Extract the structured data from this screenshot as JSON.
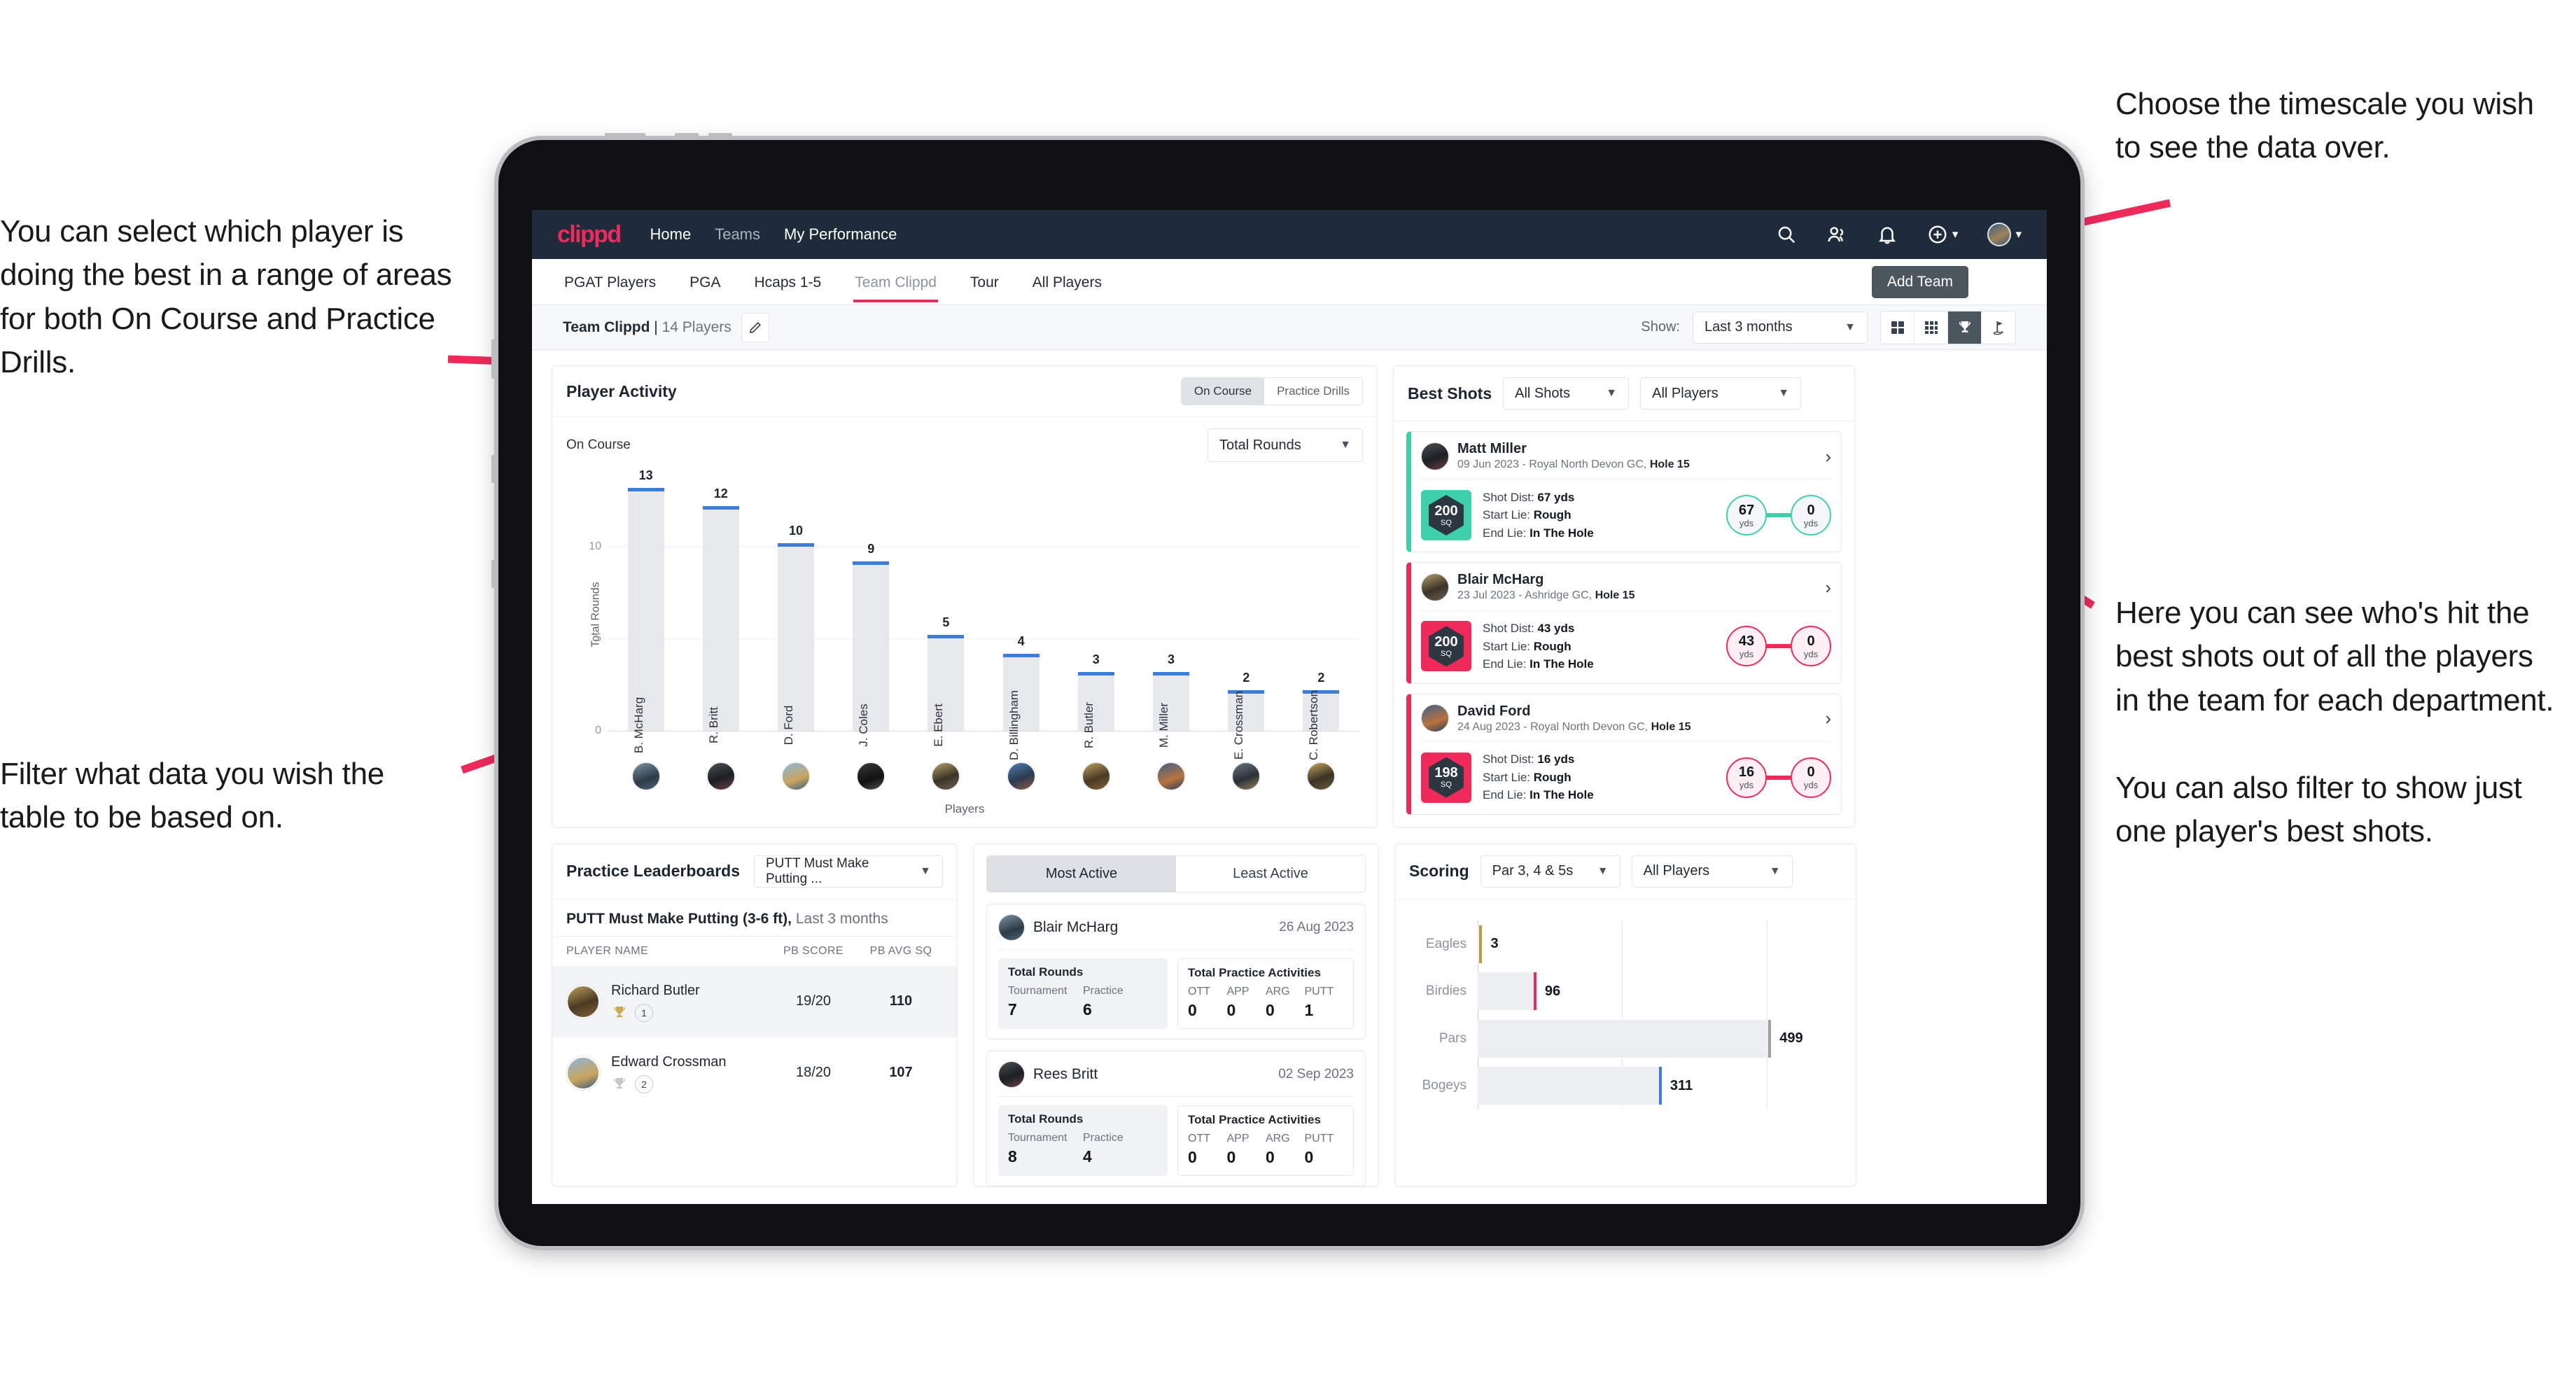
{
  "annotations": {
    "left_top": "You can select which player is doing the best in a range of areas for both On Course and Practice Drills.",
    "left_bottom": "Filter what data you wish the table to be based on.",
    "right_top": "Choose the timescale you wish to see the data over.",
    "right_mid": "Here you can see who's hit the best shots out of all the players in the team for each department.",
    "right_bottom": "You can also filter to show just one player's best shots."
  },
  "app": {
    "logo": "clippd",
    "nav": [
      {
        "label": "Home",
        "active": true
      },
      {
        "label": "Teams",
        "active": false
      },
      {
        "label": "My Performance",
        "active": true
      }
    ],
    "icons": {
      "search": "search-icon",
      "people": "people-icon",
      "bell": "notifications-icon",
      "plus": "add-circle-icon",
      "avatar": "user-avatar"
    }
  },
  "tabs": [
    {
      "label": "PGAT Players",
      "active": false
    },
    {
      "label": "PGA",
      "active": false
    },
    {
      "label": "Hcaps 1-5",
      "active": false
    },
    {
      "label": "Team Clippd",
      "active": true
    },
    {
      "label": "Tour",
      "active": false
    },
    {
      "label": "All Players",
      "active": false
    }
  ],
  "tooltip": {
    "add_team": "Add Team"
  },
  "subbar": {
    "team_name": "Team Clippd",
    "separator": " | ",
    "player_count": "14 Players",
    "edit_icon": "pencil-icon",
    "show_label": "Show:",
    "timescale": "Last 3 months",
    "views": [
      {
        "name": "grid-2x2-view",
        "active": false
      },
      {
        "name": "grid-3x3-view",
        "active": false
      },
      {
        "name": "trophy-view",
        "active": true
      },
      {
        "name": "golf-flag-view",
        "active": false
      }
    ]
  },
  "player_activity": {
    "title": "Player Activity",
    "segments": [
      {
        "label": "On Course",
        "active": true
      },
      {
        "label": "Practice Drills",
        "active": false
      }
    ],
    "sub_label": "On Course",
    "metric_select": "Total Rounds"
  },
  "best_shots": {
    "title": "Best Shots",
    "filter_shots": "All Shots",
    "filter_players": "All Players",
    "shots": [
      {
        "player": "Matt Miller",
        "meta_plain": "09 Jun 2023 - Royal North Devon GC, ",
        "meta_bold": "Hole 15",
        "sq": "200",
        "sq_unit": "SQ",
        "accent": "#3ed0ab",
        "shot_dist_label": "Shot Dist: ",
        "shot_dist": "67 yds",
        "start_lie_label": "Start Lie: ",
        "start_lie": "Rough",
        "end_lie_label": "End Lie: ",
        "end_lie": "In The Hole",
        "from_value": "67",
        "from_unit": "yds",
        "to_value": "0",
        "to_unit": "yds"
      },
      {
        "player": "Blair McHarg",
        "meta_plain": "23 Jul 2023 - Ashridge GC, ",
        "meta_bold": "Hole 15",
        "sq": "200",
        "sq_unit": "SQ",
        "accent": "#ef2a5b",
        "shot_dist_label": "Shot Dist: ",
        "shot_dist": "43 yds",
        "start_lie_label": "Start Lie: ",
        "start_lie": "Rough",
        "end_lie_label": "End Lie: ",
        "end_lie": "In The Hole",
        "from_value": "43",
        "from_unit": "yds",
        "to_value": "0",
        "to_unit": "yds"
      },
      {
        "player": "David Ford",
        "meta_plain": "24 Aug 2023 - Royal North Devon GC, ",
        "meta_bold": "Hole 15",
        "sq": "198",
        "sq_unit": "SQ",
        "accent": "#ef2a5b",
        "shot_dist_label": "Shot Dist: ",
        "shot_dist": "16 yds",
        "start_lie_label": "Start Lie: ",
        "start_lie": "Rough",
        "end_lie_label": "End Lie: ",
        "end_lie": "In The Hole",
        "from_value": "16",
        "from_unit": "yds",
        "to_value": "0",
        "to_unit": "yds"
      }
    ]
  },
  "practice_leaderboards": {
    "title": "Practice Leaderboards",
    "drill_select": "PUTT Must Make Putting ...",
    "subtitle_bold": "PUTT Must Make Putting (3-6 ft),",
    "subtitle_plain": " Last 3 months",
    "columns": [
      "PLAYER NAME",
      "PB SCORE",
      "PB AVG SQ"
    ],
    "rows": [
      {
        "name": "Richard Butler",
        "rank": "1",
        "trophy": "gold",
        "pb_score": "19/20",
        "pb_avg_sq": "110"
      },
      {
        "name": "Edward Crossman",
        "rank": "2",
        "trophy": "silver",
        "pb_score": "18/20",
        "pb_avg_sq": "107"
      }
    ]
  },
  "activity": {
    "tabs": [
      {
        "label": "Most Active",
        "active": true
      },
      {
        "label": "Least Active",
        "active": false
      }
    ],
    "cards": [
      {
        "player": "Blair McHarg",
        "date": "26 Aug 2023",
        "rounds_title": "Total Rounds",
        "rounds": [
          {
            "key": "Tournament",
            "value": "7"
          },
          {
            "key": "Practice",
            "value": "6"
          }
        ],
        "practice_title": "Total Practice Activities",
        "practice": [
          {
            "key": "OTT",
            "value": "0"
          },
          {
            "key": "APP",
            "value": "0"
          },
          {
            "key": "ARG",
            "value": "0"
          },
          {
            "key": "PUTT",
            "value": "1"
          }
        ]
      },
      {
        "player": "Rees Britt",
        "date": "02 Sep 2023",
        "rounds_title": "Total Rounds",
        "rounds": [
          {
            "key": "Tournament",
            "value": "8"
          },
          {
            "key": "Practice",
            "value": "4"
          }
        ],
        "practice_title": "Total Practice Activities",
        "practice": [
          {
            "key": "OTT",
            "value": "0"
          },
          {
            "key": "APP",
            "value": "0"
          },
          {
            "key": "ARG",
            "value": "0"
          },
          {
            "key": "PUTT",
            "value": "0"
          }
        ]
      }
    ]
  },
  "scoring": {
    "title": "Scoring",
    "filter_par": "Par 3, 4 & 5s",
    "filter_players": "All Players"
  },
  "chart_data": [
    {
      "type": "bar",
      "title": "Player Activity - On Course",
      "xlabel": "Players",
      "ylabel": "Total Rounds",
      "ylim": [
        0,
        13
      ],
      "yticks": [
        0,
        5,
        10
      ],
      "grid": true,
      "categories": [
        "B. McHarg",
        "R. Britt",
        "D. Ford",
        "J. Coles",
        "E. Ebert",
        "D. Billingham",
        "R. Butler",
        "M. Miller",
        "E. Crossman",
        "C. Robertson"
      ],
      "values": [
        13,
        12,
        10,
        9,
        5,
        4,
        3,
        3,
        2,
        2
      ],
      "bar_color": "#e6e8ec",
      "cap_color": "#3b7dd8"
    },
    {
      "type": "bar",
      "orientation": "horizontal",
      "title": "Scoring",
      "xlabel": "",
      "ylabel": "",
      "categories": [
        "Eagles",
        "Birdies",
        "Pars",
        "Bogeys"
      ],
      "values": [
        3,
        96,
        499,
        311
      ],
      "xlim": [
        0,
        620
      ],
      "colors": [
        "#bd9a4a",
        "#ef2a5b",
        "#9aa1a9",
        "#3b7dd8"
      ],
      "grid": true
    }
  ]
}
